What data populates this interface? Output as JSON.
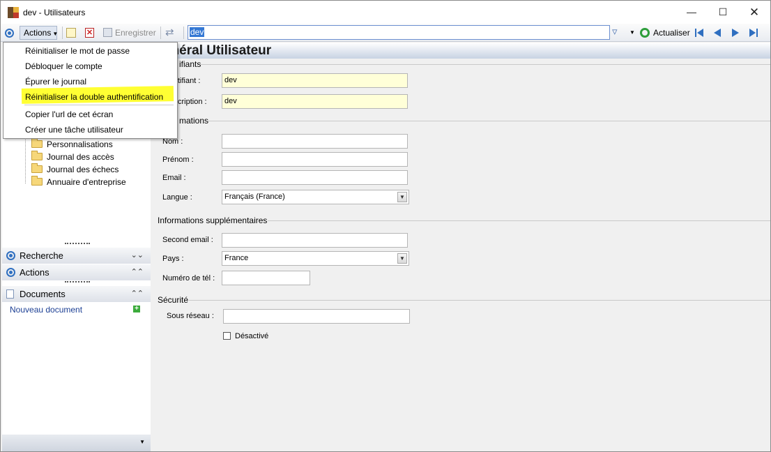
{
  "window": {
    "title": "dev -  Utilisateurs",
    "minimize_icon": "minimize-icon",
    "maximize_icon": "maximize-icon",
    "close_icon": "close-icon"
  },
  "toolbar": {
    "actions_label": "Actions",
    "save_label": "Enregistrer",
    "search_value": "dev",
    "refresh_label": "Actualiser"
  },
  "actions_menu": {
    "items": [
      {
        "label": "Réinitialiser le mot de passe"
      },
      {
        "label": "Débloquer le compte"
      },
      {
        "label": "Épurer le journal"
      },
      {
        "label": "Réinitialiser la double authentification"
      },
      {
        "label": "Copier l'url de cet écran"
      },
      {
        "label": "Créer une tâche utilisateur"
      }
    ],
    "highlight_color": "#ffff33"
  },
  "tree": {
    "items": [
      {
        "label": "Personnalisations"
      },
      {
        "label": "Journal des accès"
      },
      {
        "label": "Journal des échecs"
      },
      {
        "label": "Annuaire d'entreprise"
      }
    ]
  },
  "panels": {
    "search": "Recherche",
    "actions": "Actions",
    "documents": "Documents",
    "new_document": "Nouveau document"
  },
  "form": {
    "header": "Général Utilisateur",
    "header_visible": "énéral Utilisateur",
    "identifiants": {
      "title": "Identifiants",
      "title_visible": "ifiants",
      "identifiant_label": "Identifiant :",
      "identifiant_label_visible": "tifiant :",
      "identifiant_value": "dev",
      "description_label": "Description :",
      "description_label_visible": "cription :",
      "description_value": "dev"
    },
    "informations": {
      "title": "Informations",
      "title_visible": "mations",
      "nom_label": "Nom :",
      "nom_value": "",
      "prenom_label": "Prénom :",
      "prenom_value": "",
      "email_label": "Email :",
      "email_value": "",
      "langue_label": "Langue :",
      "langue_value": "Français (France)"
    },
    "supplementaires": {
      "title": "Informations supplémentaires",
      "second_email_label": "Second email :",
      "second_email_value": "",
      "pays_label": "Pays :",
      "pays_value": "France",
      "tel_label": "Numéro de tél :",
      "tel_value": ""
    },
    "securite": {
      "title": "Sécurité",
      "sous_reseau_label": "Sous réseau :",
      "sous_reseau_value": "",
      "desactive_label": "Désactivé",
      "desactive_checked": false
    }
  },
  "colors": {
    "accent": "#2f6fc0",
    "field_required": "#ffffd8",
    "link": "#1c3f94"
  }
}
